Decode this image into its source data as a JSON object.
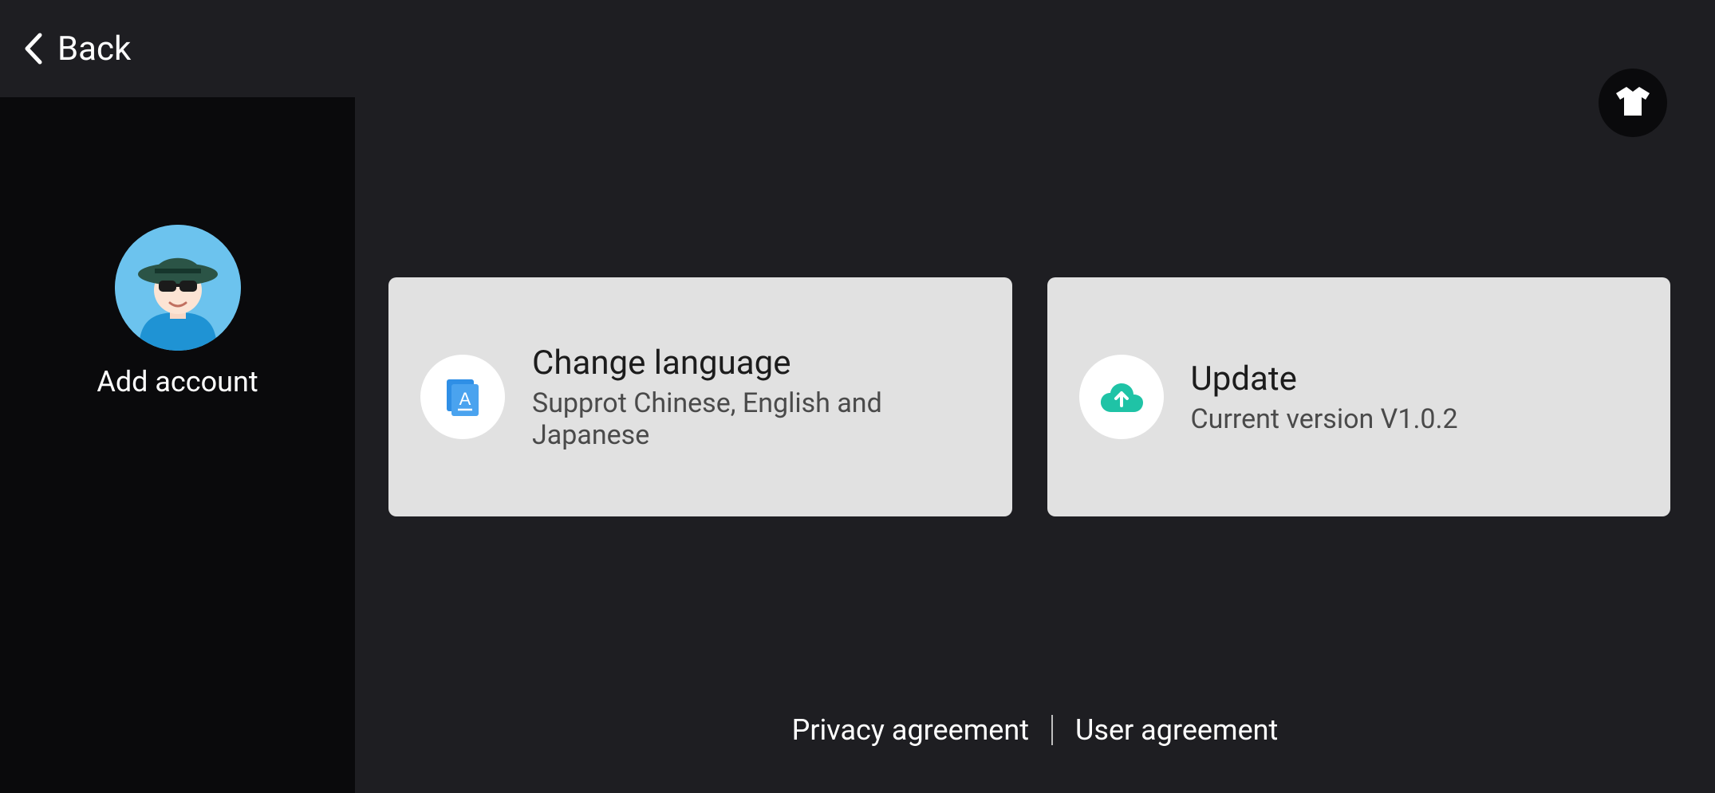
{
  "sidebar": {
    "back_label": "Back",
    "add_account_label": "Add account"
  },
  "main": {
    "cards": {
      "language": {
        "title": "Change language",
        "subtitle": "Supprot Chinese, English and Japanese"
      },
      "update": {
        "title": "Update",
        "subtitle": "Current version V1.0.2"
      }
    },
    "footer": {
      "privacy": "Privacy agreement",
      "user": "User agreement"
    }
  }
}
